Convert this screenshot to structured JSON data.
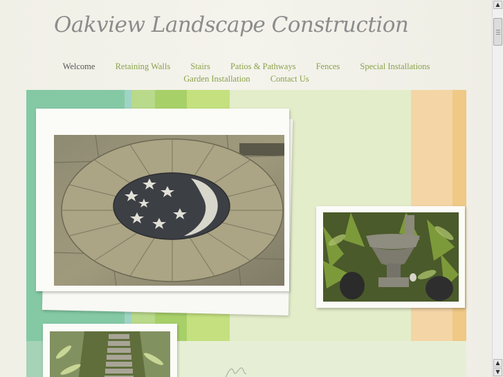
{
  "site": {
    "title": "Oakview Landscape Construction"
  },
  "nav": {
    "row1": [
      {
        "label": "Welcome",
        "active": true
      },
      {
        "label": "Retaining Walls"
      },
      {
        "label": "Stairs"
      },
      {
        "label": "Patios & Pathways"
      },
      {
        "label": "Fences"
      },
      {
        "label": "Special Installations"
      }
    ],
    "row2": [
      {
        "label": "Garden Installation"
      },
      {
        "label": "Contact Us"
      }
    ]
  },
  "images": {
    "main": "stone-patio-moon-stars",
    "urn": "garden-urn-planter",
    "stairs": "garden-stone-stairs"
  },
  "colors": {
    "nav_link": "#8aa24a",
    "nav_active": "#555555",
    "title": "#8c8c8c"
  },
  "icons": {
    "scroll_up": "▲",
    "scroll_down": "▼"
  }
}
